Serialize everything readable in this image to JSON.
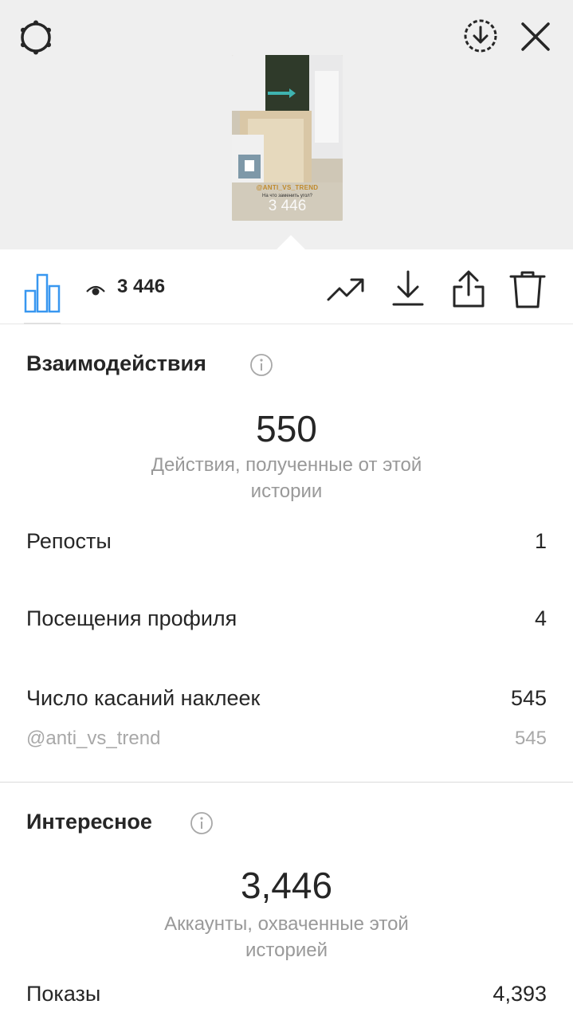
{
  "story": {
    "thumbnail_handle": "@ANTI_VS_TREND",
    "thumbnail_caption": "На что заменить угол?",
    "thumbnail_views": "3 446"
  },
  "toolbar": {
    "views": "3 446"
  },
  "interactions": {
    "title": "Взаимодействия",
    "total": "550",
    "caption_line1": "Действия, полученные от этой",
    "caption_line2": "истории",
    "rows": [
      {
        "label": "Репосты",
        "value": "1"
      },
      {
        "label": "Посещения профиля",
        "value": "4"
      },
      {
        "label": "Число касаний наклеек",
        "value": "545"
      }
    ],
    "sub_row": {
      "label": "@anti_vs_trend",
      "value": "545"
    }
  },
  "discovery": {
    "title": "Интересное",
    "total": "3,446",
    "caption_line1": "Аккаунты, охваченные этой",
    "caption_line2": "историей",
    "rows": [
      {
        "label": "Показы",
        "value": "4,393"
      }
    ]
  },
  "icons": {
    "settings": "gear-icon",
    "save_circle": "download-circle-icon",
    "close": "close-icon",
    "stats": "bar-chart-icon",
    "eye": "eye-icon",
    "promote": "trending-up-icon",
    "download": "download-icon",
    "share": "share-icon",
    "delete": "trash-icon",
    "info": "info-icon"
  },
  "colors": {
    "accent_blue": "#3897f0",
    "text": "#262626",
    "muted": "#999999",
    "topbar_bg": "#efefef"
  }
}
